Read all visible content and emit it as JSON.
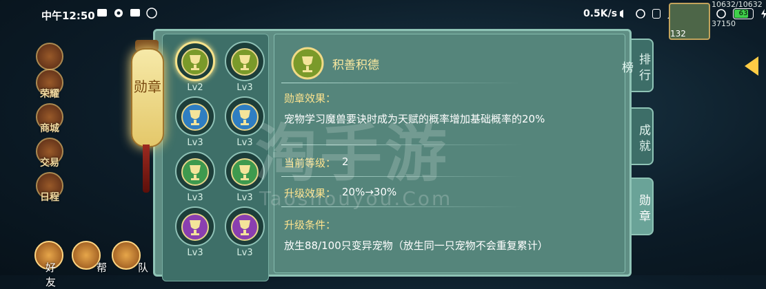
{
  "status_bar": {
    "time": "中午12:50",
    "net_speed": "0.5K/s",
    "battery": "63"
  },
  "player": {
    "stat_top": "10632/10632",
    "stat_bottom": "37150",
    "level": "132"
  },
  "hud_left": [
    {
      "label": "荣耀"
    },
    {
      "label": "商城"
    },
    {
      "label": "交易"
    },
    {
      "label": "日程"
    }
  ],
  "hud_bottom": [
    {
      "label": "好友"
    },
    {
      "label": "帮"
    },
    {
      "label": "队"
    }
  ],
  "lantern_text": "勋章",
  "badges": [
    {
      "lv": "Lv2",
      "color": "#7a9a2a",
      "selected": true
    },
    {
      "lv": "Lv3",
      "color": "#7a9a2a",
      "selected": false
    },
    {
      "lv": "Lv3",
      "color": "#2f7ec2",
      "selected": false
    },
    {
      "lv": "Lv3",
      "color": "#2f7ec2",
      "selected": false
    },
    {
      "lv": "Lv3",
      "color": "#3e9a4e",
      "selected": false
    },
    {
      "lv": "Lv3",
      "color": "#3e9a4e",
      "selected": false
    },
    {
      "lv": "Lv3",
      "color": "#8a3fb0",
      "selected": false
    },
    {
      "lv": "Lv3",
      "color": "#8a3fb0",
      "selected": false
    }
  ],
  "detail": {
    "title": "积善积德",
    "effect_label": "勋章效果：",
    "effect_text": "宠物学习魔兽要诀时成为天赋的概率增加基础概率的20%",
    "level_label": "当前等级：",
    "level_value": "2",
    "upgrade_effect_label": "升级效果：",
    "upgrade_effect_value": "20%→30%",
    "upgrade_cond_label": "升级条件：",
    "upgrade_cond_text": "放生88/100只变异宠物（放生同一只宠物不会重复累计）"
  },
  "tabs": [
    {
      "label": "排行榜",
      "active": false
    },
    {
      "label": "成就",
      "active": false
    },
    {
      "label": "勋章",
      "active": true
    }
  ],
  "watermark": {
    "main": "淘手游",
    "sub": "Taoshouyou.Com"
  }
}
